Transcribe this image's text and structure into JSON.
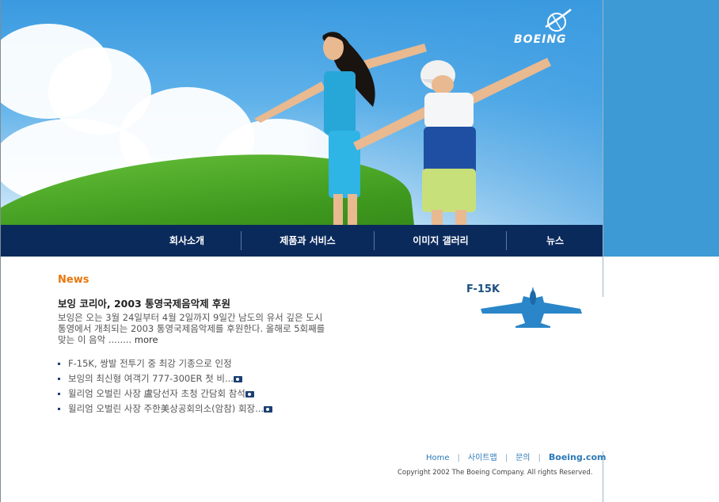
{
  "brand": {
    "logo_text": "BOEING"
  },
  "nav": {
    "items": [
      {
        "label": "회사소개"
      },
      {
        "label": "제품과 서비스"
      },
      {
        "label": "이미지 갤러리"
      },
      {
        "label": "뉴스"
      }
    ]
  },
  "news": {
    "section_title": "News",
    "headline": "보잉 코리아, 2003 통영국제음악제 후원",
    "summary": "보잉은 오는 3월 24일부터 4월 2일까지 9일간 남도의 유서 깊은 도시 통영에서 개최되는 2003 통영국제음악제를 후원한다. 올해로 5회째를 맞는 이 음악 ........",
    "more_label": "more",
    "items": [
      {
        "text": "F-15K, 쌍발 전투기 중 최강 기종으로 인정",
        "photo": false
      },
      {
        "text": "보잉의 최신형 여객기 777-300ER 첫 비...",
        "photo": true
      },
      {
        "text": "윌리엄 오벌린 사장 盧당선자 초청 간담회 참석",
        "photo": true
      },
      {
        "text": "윌리엄 오벌린 사장 주한美상공회의소(암참) 회장...",
        "photo": true
      }
    ]
  },
  "promo": {
    "label": "F-15K"
  },
  "footer": {
    "links": [
      "Home",
      "사이트맵",
      "문의"
    ],
    "site_link": "Boeing.com",
    "copyright": "Copyright 2002 The Boeing Company. All rights Reserved."
  },
  "colors": {
    "nav_bg": "#0b2a5c",
    "accent": "#e8760e",
    "link": "#2b79b8",
    "sky": "#3d9ad4"
  }
}
